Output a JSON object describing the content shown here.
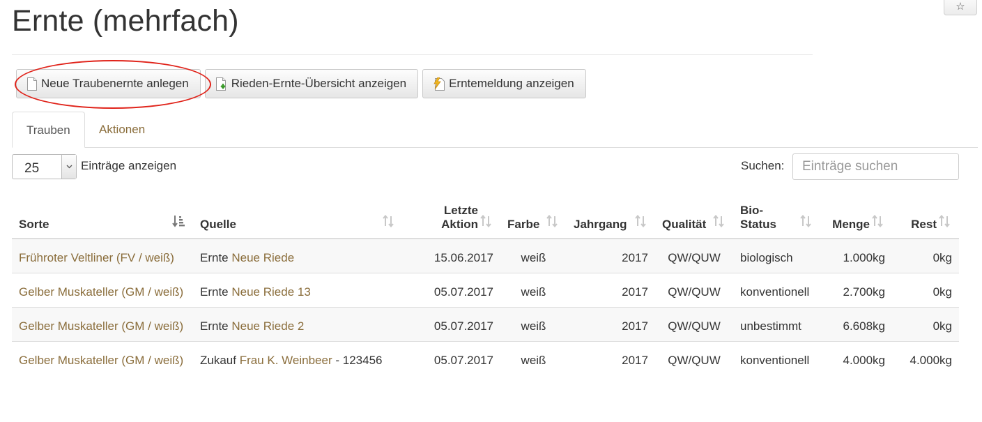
{
  "page": {
    "title": "Ernte (mehrfach)",
    "corner_icon": "star-icon"
  },
  "toolbar": [
    {
      "label": "Neue Traubenernte anlegen",
      "icon": "blank-page-icon"
    },
    {
      "label": "Rieden-Ernte-Übersicht anzeigen",
      "icon": "page-download-icon"
    },
    {
      "label": "Erntemeldung anzeigen",
      "icon": "page-lightning-icon"
    }
  ],
  "tabs": [
    {
      "label": "Trauben",
      "active": true
    },
    {
      "label": "Aktionen",
      "active": false
    }
  ],
  "length": {
    "value": "25",
    "label": "Einträge anzeigen"
  },
  "search": {
    "label": "Suchen:",
    "placeholder": "Einträge suchen"
  },
  "table": {
    "headers": [
      {
        "line1": "",
        "line2": "Sorte"
      },
      {
        "line1": "",
        "line2": "Quelle"
      },
      {
        "line1": "Letzte",
        "line2": "Aktion"
      },
      {
        "line1": "",
        "line2": "Farbe"
      },
      {
        "line1": "",
        "line2": "Jahrgang"
      },
      {
        "line1": "",
        "line2": "Qualität"
      },
      {
        "line1": "Bio-",
        "line2": "Status"
      },
      {
        "line1": "",
        "line2": "Menge"
      },
      {
        "line1": "",
        "line2": "Rest"
      }
    ],
    "rows": [
      {
        "sorte": "Frühroter Veltliner (FV / weiß)",
        "quelle_prefix": "Ernte",
        "quelle_link": "Neue Riede",
        "quelle_suffix": "",
        "aktion": "15.06.2017",
        "farbe": "weiß",
        "jahrgang": "2017",
        "qualitaet": "QW/QUW",
        "bio": "biologisch",
        "menge": "1.000kg",
        "rest": "0kg"
      },
      {
        "sorte": "Gelber Muskateller (GM / weiß)",
        "quelle_prefix": "Ernte",
        "quelle_link": "Neue Riede 13",
        "quelle_suffix": "",
        "aktion": "05.07.2017",
        "farbe": "weiß",
        "jahrgang": "2017",
        "qualitaet": "QW/QUW",
        "bio": "konventionell",
        "menge": "2.700kg",
        "rest": "0kg"
      },
      {
        "sorte": "Gelber Muskateller (GM / weiß)",
        "quelle_prefix": "Ernte",
        "quelle_link": "Neue Riede 2",
        "quelle_suffix": "",
        "aktion": "05.07.2017",
        "farbe": "weiß",
        "jahrgang": "2017",
        "qualitaet": "QW/QUW",
        "bio": "unbestimmt",
        "menge": "6.608kg",
        "rest": "0kg"
      },
      {
        "sorte": "Gelber Muskateller (GM / weiß)",
        "quelle_prefix": "Zukauf",
        "quelle_link": "Frau K. Weinbeer",
        "quelle_suffix": "- 123456",
        "aktion": "05.07.2017",
        "farbe": "weiß",
        "jahrgang": "2017",
        "qualitaet": "QW/QUW",
        "bio": "konventionell",
        "menge": "4.000kg",
        "rest": "4.000kg"
      }
    ]
  }
}
